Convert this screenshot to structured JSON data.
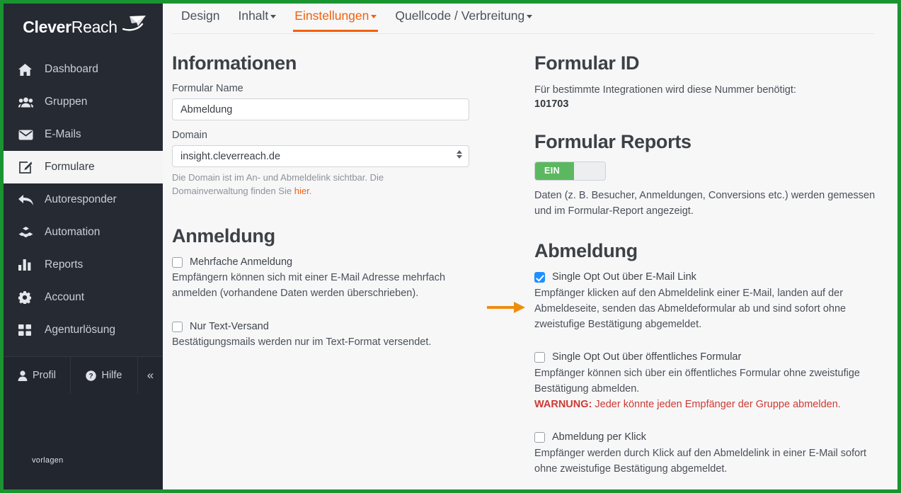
{
  "theme": {
    "border_green": "#1a9431",
    "sidebar_bg": "#252a33",
    "accent_orange": "#f2610c",
    "arrow_orange": "#ee8e10",
    "checkbox_blue": "#1e90ff",
    "toggle_green": "#5cb860",
    "warning_red": "#cc3b33"
  },
  "sidebar": {
    "logo": {
      "bold": "Clever",
      "light": "Reach",
      "icon": "paper-plane-icon"
    },
    "items": [
      {
        "label": "Dashboard",
        "icon": "home-icon",
        "active": false
      },
      {
        "label": "Gruppen",
        "icon": "users-icon",
        "active": false
      },
      {
        "label": "E-Mails",
        "icon": "envelope-icon",
        "active": false
      },
      {
        "label": "Formulare",
        "icon": "form-edit-icon",
        "active": true
      },
      {
        "label": "Autoresponder",
        "icon": "reply-all-icon",
        "active": false
      },
      {
        "label": "Automation",
        "icon": "cubes-icon",
        "active": false
      },
      {
        "label": "Reports",
        "icon": "bar-chart-icon",
        "active": false
      },
      {
        "label": "Account",
        "icon": "gear-icon",
        "active": false
      },
      {
        "label": "Agenturlösung",
        "icon": "grid-icon",
        "active": false
      }
    ],
    "footer": {
      "profil": "Profil",
      "hilfe": "Hilfe",
      "collapse": "«",
      "watermark": "vorlagen"
    }
  },
  "tabs": [
    {
      "label": "Design",
      "has_caret": false,
      "active": false
    },
    {
      "label": "Inhalt",
      "has_caret": true,
      "active": false
    },
    {
      "label": "Einstellungen",
      "has_caret": true,
      "active": true
    },
    {
      "label": "Quellcode / Verbreitung",
      "has_caret": true,
      "active": false
    }
  ],
  "informationen": {
    "title": "Informationen",
    "name_label": "Formular Name",
    "name_value": "Abmeldung",
    "name_placeholder": "Formular Name",
    "domain_label": "Domain",
    "domain_value": "insight.cleverreach.de",
    "domain_help_1": "Die Domain ist im An- und Abmeldelink sichtbar. Die",
    "domain_help_2": "Domainverwaltung finden Sie ",
    "domain_help_link": "hier",
    "domain_help_3": "."
  },
  "anmeldung": {
    "title": "Anmeldung",
    "options": [
      {
        "label": "Mehrfache Anmeldung",
        "checked": false,
        "desc_1": "Empfängern können sich mit einer E-Mail Adresse mehrfach",
        "desc_2": "anmelden (vorhandene Daten werden überschrieben)."
      },
      {
        "label": "Nur Text-Versand",
        "checked": false,
        "desc_1": "Bestätigungsmails werden nur im Text-Format versendet.",
        "desc_2": ""
      }
    ]
  },
  "formular_id": {
    "title": "Formular ID",
    "desc": "Für bestimmte Integrationen wird diese Nummer benötigt:",
    "value": "101703"
  },
  "formular_reports": {
    "title": "Formular Reports",
    "toggle_state": "EIN",
    "desc_1": "Daten (z. B. Besucher, Anmeldungen, Conversions etc.) werden gemessen",
    "desc_2": "und im Formular-Report angezeigt."
  },
  "abmeldung": {
    "title": "Abmeldung",
    "options": [
      {
        "label": "Single Opt Out über E-Mail Link",
        "checked": true,
        "desc_1": "Empfänger klicken auf den Abmeldelink einer E-Mail, landen auf der",
        "desc_2": "Abmeldeseite, senden das Abmeldeformular ab und sind sofort ohne",
        "desc_3": "zweistufige Bestätigung abgemeldet.",
        "warning_bold": "",
        "warning_text": ""
      },
      {
        "label": "Single Opt Out über öffentliches Formular",
        "checked": false,
        "desc_1": "Empfänger können sich über ein öffentliches Formular ohne zweistufige",
        "desc_2": "Bestätigung abmelden.",
        "desc_3": "",
        "warning_bold": "WARNUNG:",
        "warning_text": " Jeder könnte jeden Empfänger der Gruppe abmelden."
      },
      {
        "label": "Abmeldung per Klick",
        "checked": false,
        "desc_1": "Empfänger werden durch Klick auf den Abmeldelink in einer E-Mail sofort",
        "desc_2": "ohne zweistufige Bestätigung abgemeldet.",
        "desc_3": "",
        "warning_bold": "",
        "warning_text": ""
      }
    ]
  },
  "annotation": {
    "arrow": "orange-arrow-pointing-to-first-abmeldung-checkbox"
  }
}
